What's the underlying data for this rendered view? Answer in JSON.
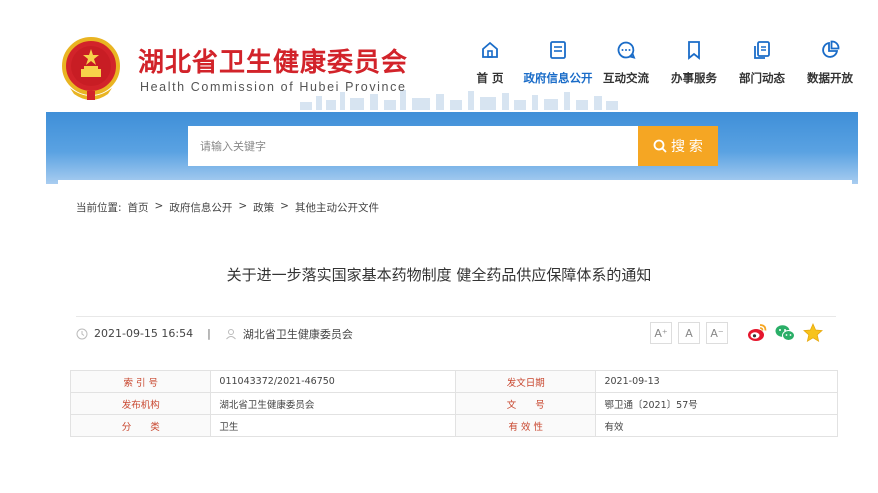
{
  "site": {
    "title": "湖北省卫生健康委员会",
    "subtitle": "Health Commission of Hubei Province"
  },
  "nav": {
    "items": [
      {
        "label": "首  页",
        "icon": "home-icon",
        "active": false
      },
      {
        "label": "政府信息公开",
        "icon": "document-list-icon",
        "active": true
      },
      {
        "label": "互动交流",
        "icon": "chat-bubble-icon",
        "active": false
      },
      {
        "label": "办事服务",
        "icon": "bookmark-icon",
        "active": false
      },
      {
        "label": "部门动态",
        "icon": "file-copy-icon",
        "active": false
      },
      {
        "label": "数据开放",
        "icon": "pie-chart-icon",
        "active": false
      }
    ]
  },
  "search": {
    "placeholder": "请输入关键字",
    "button_label": "搜 索"
  },
  "breadcrumb": {
    "prefix": "当前位置:",
    "items": [
      "首页",
      "政府信息公开",
      "政策",
      "其他主动公开文件"
    ],
    "separator": ">"
  },
  "article": {
    "title": "关于进一步落实国家基本药物制度 健全药品供应保障体系的通知",
    "datetime": "2021-09-15 16:54",
    "divider": "|",
    "source": "湖北省卫生健康委员会",
    "font_buttons": [
      "A⁺",
      "A",
      "A⁻"
    ]
  },
  "info_table": {
    "rows": [
      [
        {
          "k": "索 引 号",
          "v": "011043372/2021-46750"
        },
        {
          "k": "发文日期",
          "v": "2021-09-13"
        }
      ],
      [
        {
          "k": "发布机构",
          "v": "湖北省卫生健康委员会"
        },
        {
          "k": "文　　号",
          "v": "鄂卫通〔2021〕57号"
        }
      ],
      [
        {
          "k": "分　　类",
          "v": "卫生"
        },
        {
          "k": "有 效 性",
          "v": "有效"
        }
      ]
    ]
  },
  "colors": {
    "brand_red": "#d2232a",
    "accent_blue": "#1a6cc8",
    "search_orange": "#f5a623"
  }
}
